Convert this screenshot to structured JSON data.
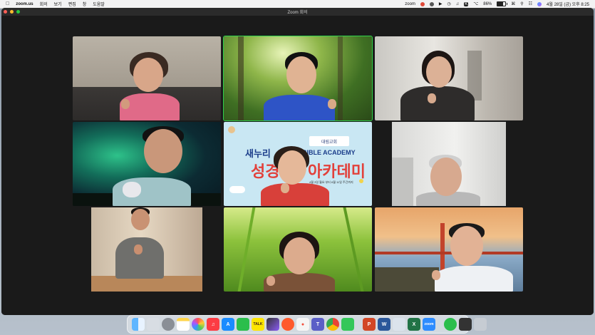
{
  "menubar": {
    "app_name": "zoom.us",
    "menus": [
      "회의",
      "보기",
      "편집",
      "창",
      "도움말"
    ],
    "zoom_label": "zoom",
    "battery": "86%",
    "datetime": "4월 28일 (금) 오후 8:25"
  },
  "window": {
    "title": "Zoom 회의"
  },
  "slide": {
    "logo_text": "대림교회",
    "line1_a": "새누리",
    "line1_b": "BIBLE ACADEMY",
    "line2_a": "성경",
    "line2_b": "아카데미",
    "date_note": "4월 3일 월요 부터 6월 11일 주간까지"
  },
  "dock": {
    "apps": [
      "finder-icon",
      "launchpad-icon",
      "settings-icon",
      "notes-icon",
      "photos-icon",
      "music-icon",
      "appstore-icon",
      "line-icon",
      "talk-icon",
      "finalcut-icon",
      "davinci-icon",
      "shape-icon",
      "teams-icon",
      "chrome-icon",
      "messages-icon",
      "powerpoint-icon",
      "word-icon",
      "preview-icon",
      "excel-icon",
      "zoom-icon",
      "dropbox-icon",
      "storage-icon",
      "trash-icon"
    ],
    "talk_label": "TALK",
    "zoom_label": "zoom"
  },
  "colors": {
    "active_speaker": "#2fd14c",
    "window_bg": "#1f1f1f"
  }
}
